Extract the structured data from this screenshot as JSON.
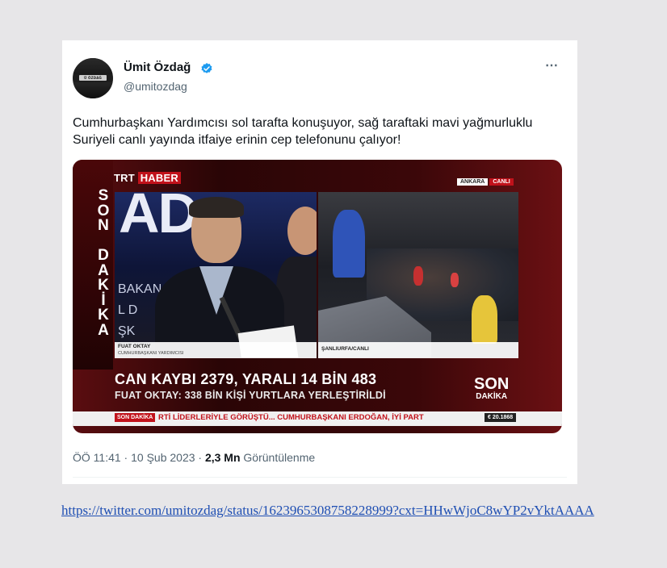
{
  "tweet": {
    "author_name": "Ümit Özdağ",
    "handle": "@umitozdag",
    "verified": true,
    "avatar_text": "Ü ÖZDAĞ 1976",
    "text": "Cumhurbaşkanı Yardımcısı sol tarafta konuşuyor, sağ taraftaki mavi yağmurluklu Suriyeli canlı yayında itfaiye erinin cep telefonunu çalıyor!",
    "time": "ÖÖ 11:41 · 10 Şub 2023 · ",
    "views_count": "2,3 Mn",
    "views_label": " Görüntülenme",
    "more_icon": "⋯"
  },
  "media": {
    "channel_prefix": "TRT ",
    "channel_name": "HABER",
    "badge_city": "ANKARA",
    "badge_live": "CANLI",
    "vertical_text": "S\nO\nN\n\nD\nA\nK\nİ\nK\nA",
    "bg_letters": "AD",
    "bg_text": "BAKAN\nL D\nŞK",
    "left_name": "FUAT OKTAY",
    "left_title": "CUMHURBAŞKANI YARDIMCISI",
    "right_location": "ŞANLIURFA/CANLI",
    "headline": "CAN KAYBI 2379, YARALI 14 BİN 483",
    "subline": "FUAT OKTAY: 338 BİN KİŞİ YURTLARA YERLEŞTİRİLDİ",
    "logo_line1": "SON",
    "logo_line2": "DAKİKA",
    "ticker_tag": "SON DAKİKA",
    "ticker_text": "RTİ LİDERLERİYLE GÖRÜŞTÜ... CUMHURBAŞKANI ERDOĞAN, İYİ PART",
    "ticker_stock": "€ 20.1868"
  },
  "link": {
    "url": "https://twitter.com/umitozdag/status/1623965308758228999?cxt=HHwWjoC8wYP2vYktAAAA"
  },
  "colors": {
    "verified_blue": "#1d9bf0",
    "trt_red": "#c1121b",
    "link_blue": "#1f4fb3"
  }
}
